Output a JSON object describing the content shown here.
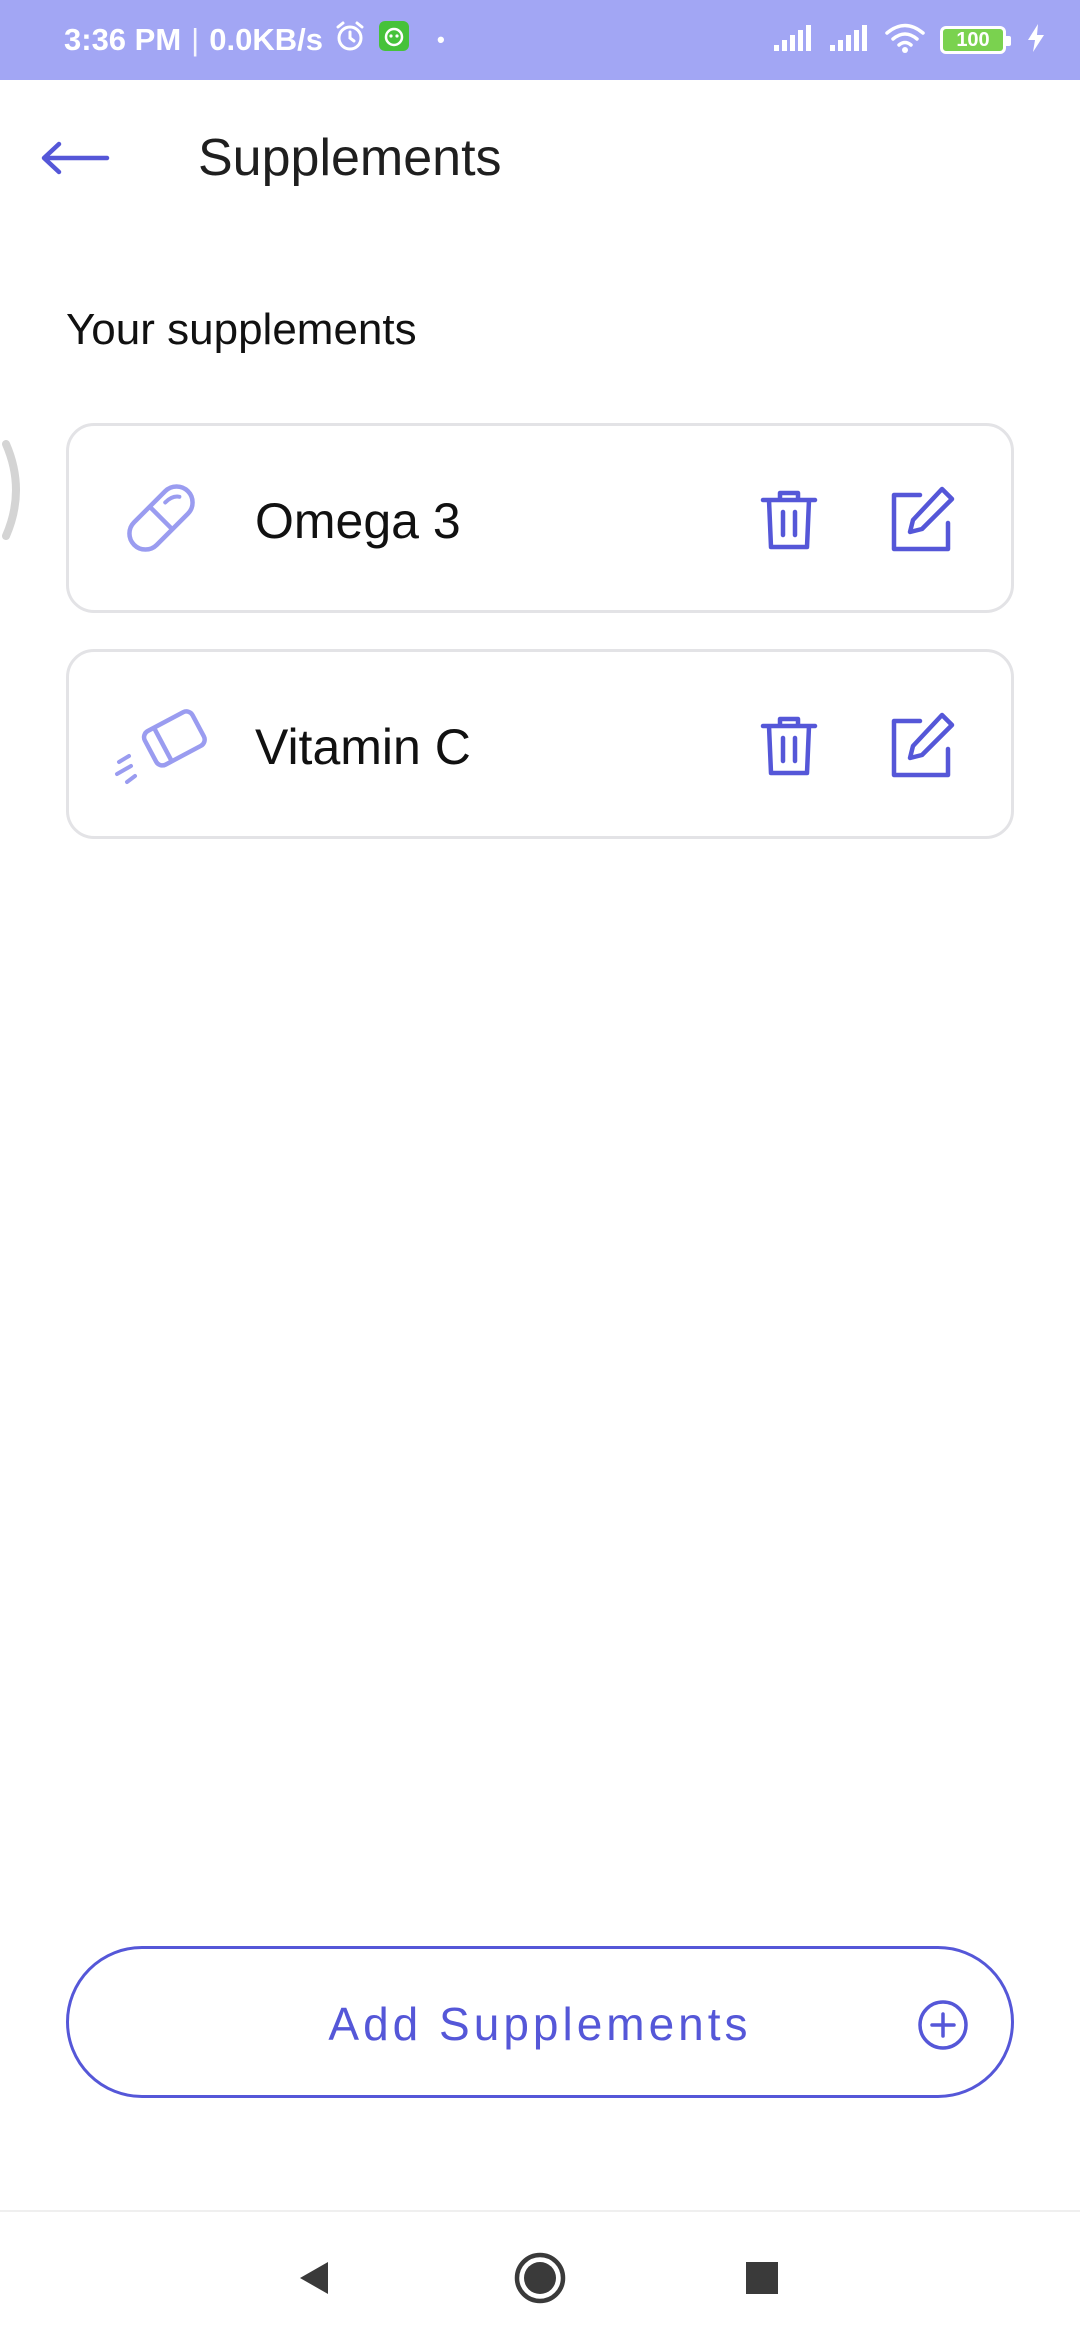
{
  "status_bar": {
    "time": "3:36 PM",
    "separator": "|",
    "speed": "0.0KB/s",
    "dot": "•",
    "battery": "100",
    "background_color": "#a2a6f4"
  },
  "header": {
    "title": "Supplements",
    "back_icon": "arrow-left-icon"
  },
  "section_title": "Your supplements",
  "supplements": [
    {
      "name": "Omega 3",
      "icon": "capsule-icon"
    },
    {
      "name": "Vitamin C",
      "icon": "tablet-icon"
    }
  ],
  "actions": {
    "delete_icon": "trash-icon",
    "edit_icon": "edit-icon"
  },
  "add_button": {
    "label": "Add Supplements",
    "icon": "plus-circle-icon"
  },
  "nav_bar": {
    "back": "triangle-back-icon",
    "home": "circle-home-icon",
    "recents": "square-recents-icon"
  },
  "colors": {
    "accent": "#5557d8",
    "icon_light": "#9a9cf0",
    "card_border": "#e3e3e6"
  }
}
